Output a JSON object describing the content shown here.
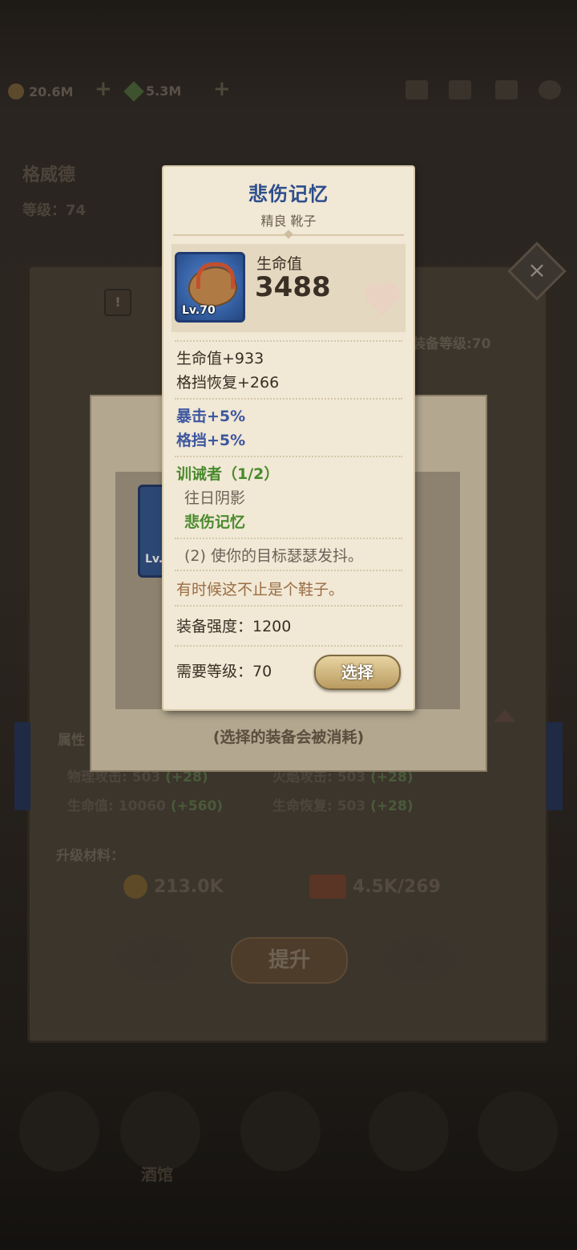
{
  "topbar": {
    "gold": "20.6M",
    "leaf": "5.3M"
  },
  "hero": {
    "name": "格威德",
    "level": "等级：74"
  },
  "background_panel": {
    "close_symbol": "×",
    "warning_symbol": "!",
    "required_level_partial": "装备等级:70",
    "attributes_label": "属性",
    "stats": [
      {
        "label": "物理攻击:",
        "value": "503",
        "bonus": "(+28)"
      },
      {
        "label": "火焰攻击:",
        "value": "503",
        "bonus": "(+28)"
      },
      {
        "label": "生命值:",
        "value": "10060",
        "bonus": "(+560)"
      },
      {
        "label": "生命恢复:",
        "value": "503",
        "bonus": "(+28)"
      }
    ],
    "upgrade_materials_label": "升级材料：",
    "materials": [
      {
        "icon": "coin-icon",
        "amount": "213.0K"
      },
      {
        "icon": "scroll-icon",
        "amount": "4.5K/269"
      }
    ],
    "upgrade_button": "提升"
  },
  "bottom_nav": {
    "tavern_label": "酒馆"
  },
  "mid_dialog": {
    "slot_level": "Lv.",
    "hint": "(选择的装备会被消耗)"
  },
  "item_card": {
    "name": "悲伤记忆",
    "quality_type": "精良 靴子",
    "icon": "sandal-icon",
    "level_badge": "Lv.70",
    "main_stat_label": "生命值",
    "main_stat_value": "3488",
    "base_stats": [
      "生命值+933",
      "格挡恢复+266"
    ],
    "bonus_stats": [
      "暴击+5%",
      "格挡+5%"
    ],
    "set": {
      "name": "训诫者（1/2）",
      "members": [
        {
          "name": "往日阴影",
          "owned": false
        },
        {
          "name": "悲伤记忆",
          "owned": true
        }
      ],
      "effect": "(2) 使你的目标瑟瑟发抖。"
    },
    "flavor": "有时候这不止是个鞋子。",
    "gear_score": "装备强度：1200",
    "required_level": "需要等级：70",
    "select_button": "选择"
  },
  "colors": {
    "title_blue": "#2d4e8c",
    "bonus_blue": "#3d57a0",
    "set_green": "#4a8a2e",
    "flavor_brown": "#9a6d44",
    "parchment": "#f1e8d5"
  }
}
